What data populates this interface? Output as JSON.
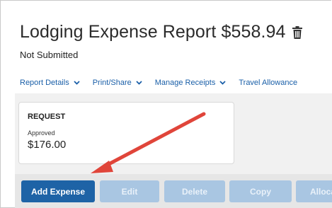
{
  "report": {
    "title": "Lodging Expense Report $558.94",
    "status": "Not Submitted"
  },
  "nav": {
    "items": [
      {
        "label": "Report Details"
      },
      {
        "label": "Print/Share"
      },
      {
        "label": "Manage Receipts"
      },
      {
        "label": "Travel Allowance"
      }
    ]
  },
  "request_card": {
    "title": "REQUEST",
    "status": "Approved",
    "amount": "$176.00"
  },
  "toolbar": {
    "add_expense": "Add Expense",
    "edit": "Edit",
    "delete": "Delete",
    "copy": "Copy",
    "allocate": "Alloca"
  },
  "colors": {
    "link": "#1a5fa8",
    "primary_button": "#1e63a6",
    "disabled_button": "#a9c6e2",
    "annotation_arrow": "#e0453a"
  },
  "icons": {
    "delete_report": "trash-icon",
    "nav_dropdown": "chevron-down-icon",
    "annotation": "red-arrow-icon"
  }
}
